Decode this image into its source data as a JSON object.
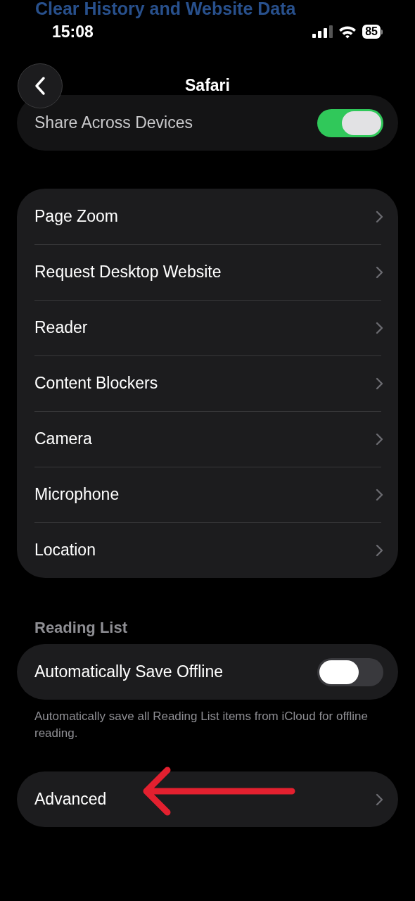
{
  "background_text": {
    "title": "Clear History and Website Data"
  },
  "status_bar": {
    "time": "15:08",
    "battery": "85"
  },
  "nav": {
    "title": "Safari"
  },
  "share": {
    "label": "Share Across Devices",
    "on": true
  },
  "website_settings": [
    {
      "label": "Page Zoom"
    },
    {
      "label": "Request Desktop Website"
    },
    {
      "label": "Reader"
    },
    {
      "label": "Content Blockers"
    },
    {
      "label": "Camera"
    },
    {
      "label": "Microphone"
    },
    {
      "label": "Location"
    }
  ],
  "reading_list": {
    "header": "Reading List",
    "rows": [
      {
        "label": "Automatically Save Offline",
        "on": false
      }
    ],
    "footer": "Automatically save all Reading List items from iCloud for offline reading."
  },
  "advanced": {
    "label": "Advanced"
  }
}
